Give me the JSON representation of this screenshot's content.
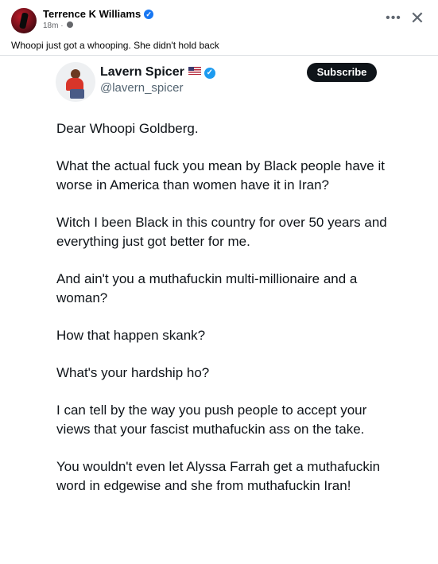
{
  "post": {
    "author": "Terrence K Williams",
    "time": "18m ·",
    "caption": "Whoopi just got a whooping. She didn't hold back",
    "more_icon": "more-horizontal-icon",
    "close_icon": "close-icon"
  },
  "tweet": {
    "name": "Lavern Spicer",
    "handle": "@lavern_spicer",
    "subscribe_label": "Subscribe",
    "paragraphs": [
      "Dear Whoopi Goldberg.",
      "What the actual fuck you mean by Black people have it worse in America than women have it in Iran?",
      "Witch I been Black in this country for over 50 years and everything just got better for me.",
      "And ain't you a muthafuckin multi-millionaire and a woman?",
      "How that happen skank?",
      "What's your hardship ho?",
      "I can tell by the way you push people to accept your views that your fascist muthafuckin ass on the take.",
      "You wouldn't even let Alyssa Farrah get a muthafuckin word in edgewise and she from muthafuckin Iran!"
    ]
  },
  "colors": {
    "facebook_verified": "#1877f2",
    "twitter_verified": "#1d9bf0",
    "subscribe_bg": "#0f1419"
  }
}
